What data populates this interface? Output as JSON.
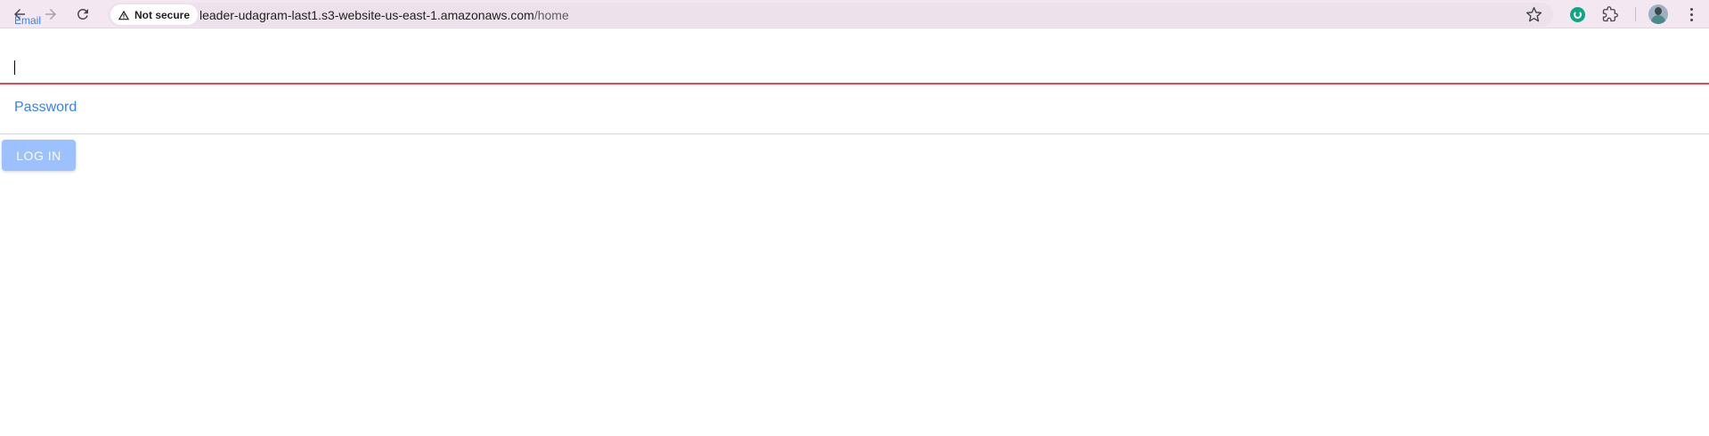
{
  "browser": {
    "security_label": "Not secure",
    "url_host": "leader-udagram-last1.s3-website-us-east-1.amazonaws.com",
    "url_path": "/home",
    "icons": [
      "back-arrow-icon",
      "forward-arrow-icon",
      "reload-icon",
      "warning-triangle-icon",
      "bookmark-star-icon",
      "grammarly-icon",
      "extensions-puzzle-icon",
      "profile-avatar-icon",
      "kebab-menu-icon"
    ]
  },
  "form": {
    "email_label": "Email",
    "email_value": "",
    "password_label": "Password",
    "login_label": "LOG IN"
  },
  "colors": {
    "toolbar_bg": "#f3e7f1",
    "primary": "#3880ff",
    "invalid": "#eb445a",
    "login_button_disabled": "#9dc0ff"
  }
}
